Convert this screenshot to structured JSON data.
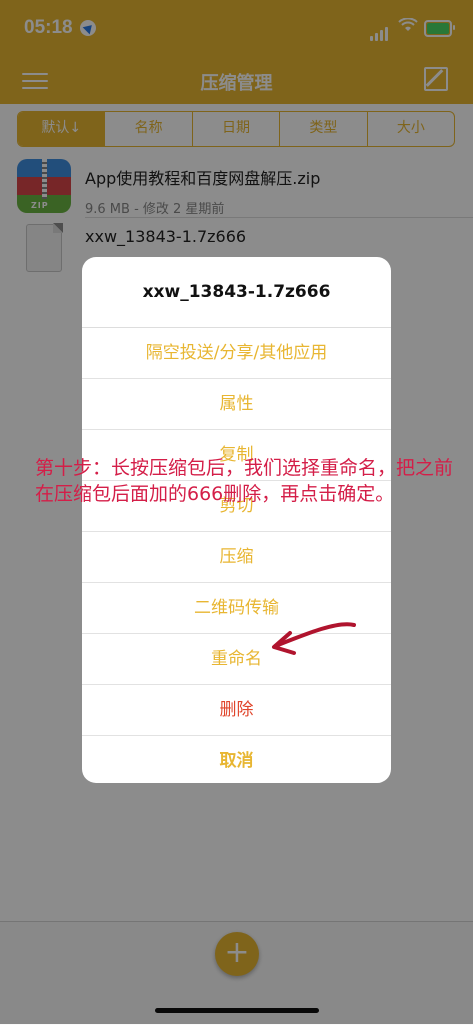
{
  "status_bar": {
    "time": "05:18"
  },
  "nav": {
    "title": "压缩管理"
  },
  "sort_tabs": [
    "默认↓",
    "名称",
    "日期",
    "类型",
    "大小"
  ],
  "files": [
    {
      "name": "App使用教程和百度网盘解压.zip",
      "meta": "9.6 MB - 修改 2 星期前",
      "icon": "zip-icon",
      "icon_label": "ZIP"
    },
    {
      "name": "xxw_13843-1.7z666",
      "icon": "document-icon"
    }
  ],
  "action_sheet": {
    "title": "xxw_13843-1.7z666",
    "items": [
      "隔空投送/分享/其他应用",
      "属性",
      "复制",
      "剪切",
      "压缩",
      "二维码传输",
      "重命名",
      "删除",
      "取消"
    ]
  },
  "annotation": {
    "text": "第十步：长按压缩包后，我们选择重命名，把之前在压缩包后面加的666删除，再点击确定。"
  },
  "bottom": {
    "add_label": "+"
  },
  "colors": {
    "accent": "#e8b632",
    "danger": "#e0452b",
    "annotation": "#d41e48"
  }
}
